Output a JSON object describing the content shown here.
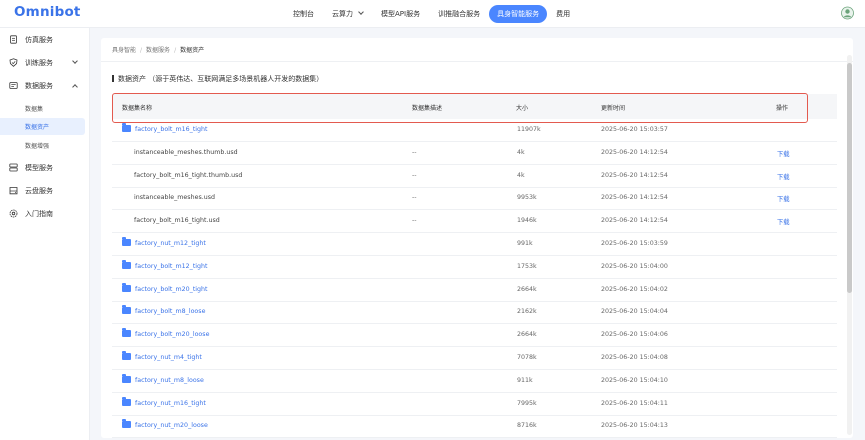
{
  "app": {
    "logo": "Omnibot"
  },
  "topnav": [
    {
      "label": "控制台",
      "active": false,
      "dropdown": false
    },
    {
      "label": "云算力",
      "active": false,
      "dropdown": true
    },
    {
      "label": "模型API服务",
      "active": false,
      "dropdown": false
    },
    {
      "label": "训推融合服务",
      "active": false,
      "dropdown": false
    },
    {
      "label": "具身智能服务",
      "active": true,
      "dropdown": false
    },
    {
      "label": "费用",
      "active": false,
      "dropdown": false
    }
  ],
  "sidebar": {
    "items": [
      {
        "label": "仿真服务",
        "icon": "doc-icon",
        "arrow": ""
      },
      {
        "label": "训练服务",
        "icon": "shield-icon",
        "arrow": "down"
      },
      {
        "label": "数据服务",
        "icon": "database-icon",
        "arrow": "up"
      }
    ],
    "sub_items": [
      {
        "label": "数据集",
        "active": false
      },
      {
        "label": "数据资产",
        "active": true
      },
      {
        "label": "数据增强",
        "active": false
      }
    ],
    "items_after": [
      {
        "label": "模型服务",
        "icon": "server-icon"
      },
      {
        "label": "云盘服务",
        "icon": "disk-icon"
      },
      {
        "label": "入门指南",
        "icon": "gear-icon"
      }
    ]
  },
  "breadcrumb": [
    "具身智能",
    "数据服务",
    "数据资产"
  ],
  "section_title": "数据资产 （源于英伟达、互联网满足多场景机器人开发的数据集）",
  "table": {
    "headers": [
      "数据集名称",
      "数据集描述",
      "大小",
      "更新时间",
      "操作"
    ],
    "rows": [
      {
        "name": "factory_bolt_m16_tight",
        "folder": true,
        "desc": "",
        "size": "11907k",
        "time": "2025-06-20 15:03:57",
        "action": ""
      },
      {
        "name": "instanceable_meshes.thumb.usd",
        "folder": false,
        "desc": "--",
        "size": "4k",
        "time": "2025-06-20 14:12:54",
        "action": "下载"
      },
      {
        "name": "factory_bolt_m16_tight.thumb.usd",
        "folder": false,
        "desc": "--",
        "size": "4k",
        "time": "2025-06-20 14:12:54",
        "action": "下载"
      },
      {
        "name": "instanceable_meshes.usd",
        "folder": false,
        "desc": "--",
        "size": "9953k",
        "time": "2025-06-20 14:12:54",
        "action": "下载"
      },
      {
        "name": "factory_bolt_m16_tight.usd",
        "folder": false,
        "desc": "--",
        "size": "1946k",
        "time": "2025-06-20 14:12:54",
        "action": "下载"
      },
      {
        "name": "factory_nut_m12_tight",
        "folder": true,
        "desc": "",
        "size": "991k",
        "time": "2025-06-20 15:03:59",
        "action": ""
      },
      {
        "name": "factory_bolt_m12_tight",
        "folder": true,
        "desc": "",
        "size": "1753k",
        "time": "2025-06-20 15:04:00",
        "action": ""
      },
      {
        "name": "factory_bolt_m20_tight",
        "folder": true,
        "desc": "",
        "size": "2664k",
        "time": "2025-06-20 15:04:02",
        "action": ""
      },
      {
        "name": "factory_bolt_m8_loose",
        "folder": true,
        "desc": "",
        "size": "2162k",
        "time": "2025-06-20 15:04:04",
        "action": ""
      },
      {
        "name": "factory_bolt_m20_loose",
        "folder": true,
        "desc": "",
        "size": "2664k",
        "time": "2025-06-20 15:04:06",
        "action": ""
      },
      {
        "name": "factory_nut_m4_tight",
        "folder": true,
        "desc": "",
        "size": "7078k",
        "time": "2025-06-20 15:04:08",
        "action": ""
      },
      {
        "name": "factory_nut_m8_loose",
        "folder": true,
        "desc": "",
        "size": "911k",
        "time": "2025-06-20 15:04:10",
        "action": ""
      },
      {
        "name": "factory_nut_m16_tight",
        "folder": true,
        "desc": "",
        "size": "7995k",
        "time": "2025-06-20 15:04:11",
        "action": ""
      },
      {
        "name": "factory_nut_m20_loose",
        "folder": true,
        "desc": "",
        "size": "8716k",
        "time": "2025-06-20 15:04:13",
        "action": ""
      }
    ]
  },
  "colors": {
    "accent": "#4a86ff",
    "link": "#3a73e8",
    "highlight": "#e35a4f"
  }
}
